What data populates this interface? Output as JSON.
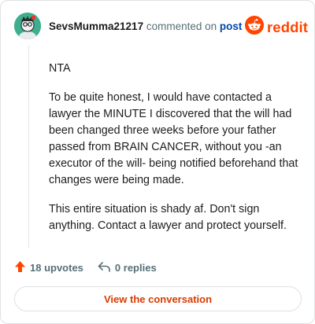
{
  "header": {
    "username": "SevsMumma21217",
    "action_text": "commented on",
    "post_link": "post",
    "brand": "reddit"
  },
  "comment": {
    "paragraphs": [
      "NTA",
      "To be quite honest, I would have contacted a lawyer the MINUTE I discovered that the will had been changed three weeks before your father passed from BRAIN CANCER, without you -an executor of the will- being notified beforehand that changes were being made.",
      "This entire situation is shady af. Don't sign anything. Contact a lawyer and protect yourself."
    ]
  },
  "footer": {
    "upvotes": "18 upvotes",
    "replies": "0 replies"
  },
  "cta": {
    "label": "View the conversation"
  },
  "colors": {
    "brand": "#ff4500",
    "link": "#0045ac",
    "cta_text": "#d93a00"
  },
  "icons": [
    "avatar",
    "reddit-snoo-icon",
    "upvote-arrow-icon",
    "reply-icon"
  ]
}
